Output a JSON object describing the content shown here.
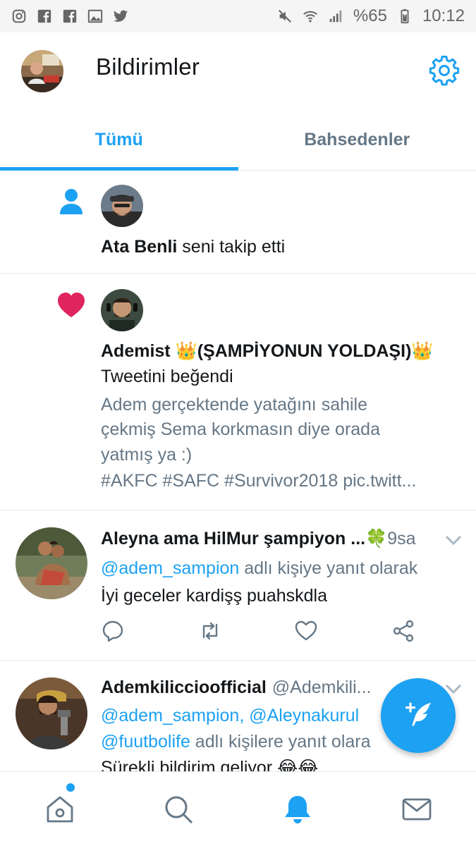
{
  "statusbar": {
    "battery_percent": "%65",
    "time": "10:12",
    "left_icons": [
      "instagram-icon",
      "facebook-icon",
      "facebook-icon",
      "gallery-icon",
      "twitter-icon"
    ],
    "right_icons": [
      "mute-icon",
      "wifi-icon",
      "signal-icon",
      "battery-icon"
    ]
  },
  "header": {
    "title": "Bildirimler"
  },
  "tabs": [
    {
      "label": "Tümü",
      "active": true
    },
    {
      "label": "Bahsedenler",
      "active": false
    }
  ],
  "notifications": [
    {
      "type": "follow",
      "icon": "person-icon",
      "name": "Ata Benli",
      "text": " seni takip etti"
    },
    {
      "type": "like",
      "icon": "heart-icon",
      "name": "Ademist 👑(ŞAMPİYONUN YOLDAŞI)👑",
      "action": "Tweetini beğendi",
      "tweet_lines": [
        "Adem gerçektende yatağını sahile",
        "çekmiş Sema korkmasın diye orada",
        "yatmış ya :)",
        "#AKFC #SAFC #Survivor2018 pic.twitt..."
      ]
    },
    {
      "type": "reply",
      "name": "Aleyna ama HilMur şampiyon ...🍀",
      "time": "9sa",
      "reply_to_handle": "@adem_sampion",
      "reply_to_text": " adlı kişiye yanıt olarak",
      "body": "İyi geceler kardişş puahskdla"
    },
    {
      "type": "reply",
      "name": "Ademkiliccioofficial",
      "handle": "@Ademkili...",
      "reply_handles": "@adem_sampion, @Aleynakurul",
      "reply_handle2": "@fuutbolife",
      "reply_to_text": " adlı kişilere yanıt olara",
      "body": "Sürekli bildirim geliyor 😂😂"
    }
  ],
  "colors": {
    "accent": "#1da1f2",
    "like": "#e0245e",
    "secondary_text": "#657786"
  }
}
